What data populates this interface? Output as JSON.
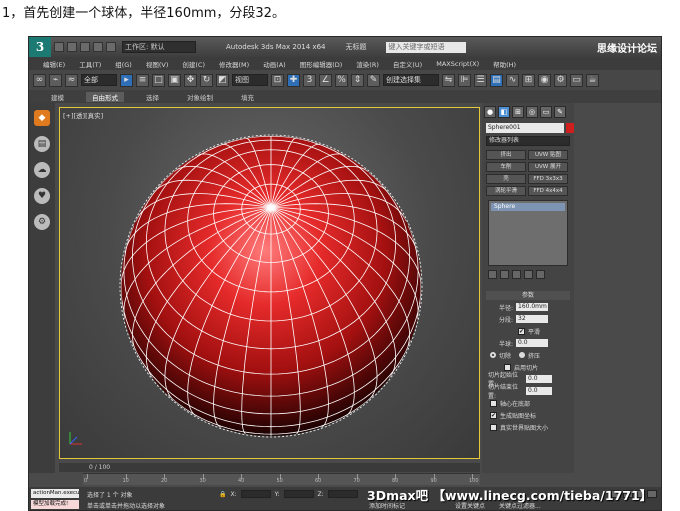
{
  "caption": "1，首先创建一个球体，半径160mm，分段32。",
  "titlebar": {
    "logo": "3",
    "workspace": "工作区: 默认",
    "app_title": "Autodesk 3ds Max  2014 x64",
    "doc_title": "无标题",
    "search_placeholder": "键入关键字或短语",
    "watermark_top": "思缘设计论坛"
  },
  "menu": [
    "编辑(E)",
    "工具(T)",
    "组(G)",
    "视图(V)",
    "创建(C)",
    "修改器(M)",
    "动画(A)",
    "图形编辑器(D)",
    "渲染(R)",
    "自定义(U)",
    "MAXScript(X)",
    "帮助(H)"
  ],
  "toolbar": {
    "selection_filter": "全部",
    "ref_coord": "视图",
    "named_sel": "创建选择集"
  },
  "ribbon": {
    "tabs": [
      "建模",
      "自由形式",
      "选择",
      "对象绘制",
      "填充"
    ],
    "selected": 1
  },
  "viewport": {
    "label": "[+][透][真实]"
  },
  "sphere_color": "#c91c1c",
  "command_panel": {
    "object_name": "Sphere001",
    "modifier_list": "修改器列表",
    "mod_buttons": [
      "挤出",
      "UVW 贴图",
      "车削",
      "UVW 展开",
      "壳",
      "FFD 3x3x3",
      "涡轮平滑",
      "FFD 4x4x4"
    ],
    "stack_item": "Sphere",
    "params_title": "参数",
    "radius_label": "半径:",
    "radius_value": "160.0mm",
    "segments_label": "分段:",
    "segments_value": "32",
    "smooth_label": "平滑",
    "hemisphere_label": "半球:",
    "hemisphere_value": "0.0",
    "chop_label": "切除",
    "squash_label": "挤压",
    "slice_on_label": "启用切片",
    "slice_from_label": "切片起始位置:",
    "slice_from_value": "0.0",
    "slice_to_label": "切片结束位置:",
    "slice_to_value": "0.0",
    "base_pivot_label": "轴心在底部",
    "gen_map_label": "生成贴图坐标",
    "real_world_label": "真实世界贴图大小"
  },
  "timeline": {
    "frame": "0 / 100",
    "ticks": [
      "0",
      "10",
      "20",
      "30",
      "40",
      "50",
      "60",
      "70",
      "80",
      "90",
      "100"
    ]
  },
  "status": {
    "listener1": "actionMan.execu",
    "listener2": "模型加载完成!",
    "line1": "选择了 1 个 对象",
    "line2": "单击或单击并拖动以选择对象",
    "add_tag": "添加时间标记",
    "set_key": "设置关键点",
    "key_filter": "关键点过滤器..."
  },
  "watermark": "3Dmax吧 【www.linecg.com/tieba/1771】"
}
